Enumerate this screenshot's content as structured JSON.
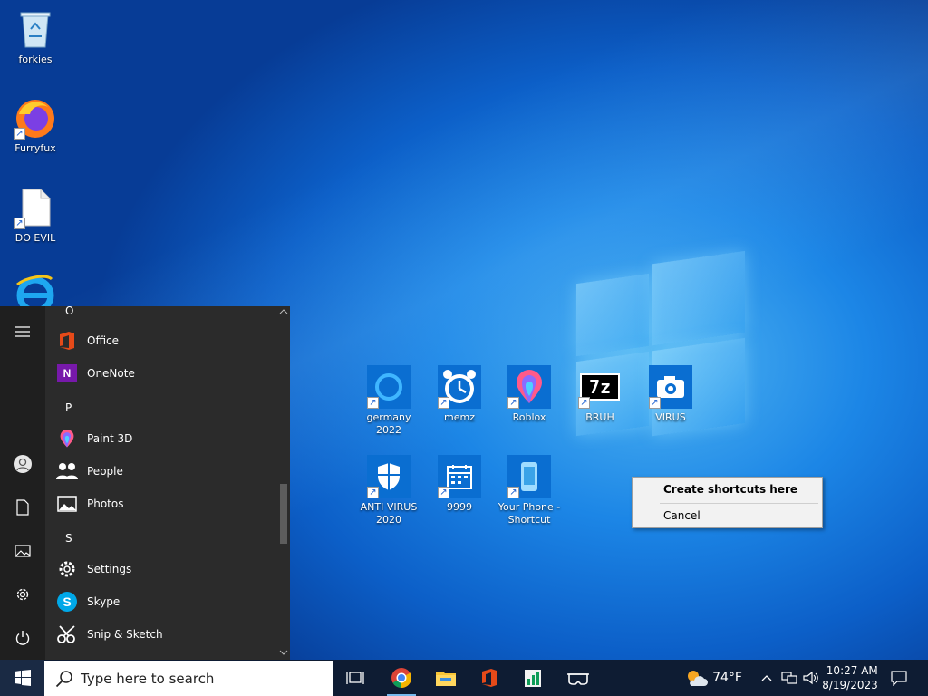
{
  "desktop": {
    "icons": [
      {
        "label": "forkies",
        "icon": "recycle-bin-icon"
      },
      {
        "label": "Furryfux",
        "icon": "firefox-icon"
      },
      {
        "label": "DO EVIL",
        "icon": "blank-file-icon"
      },
      {
        "label": "germany 2022",
        "icon": "cortana-icon"
      },
      {
        "label": "memz",
        "icon": "alarm-clock-icon"
      },
      {
        "label": "Roblox",
        "icon": "paint-3d-icon"
      },
      {
        "label": "BRUH",
        "icon": "7zip-icon"
      },
      {
        "label": "VIRUS",
        "icon": "camera-icon"
      },
      {
        "label": "ANTI VIRUS 2020",
        "icon": "shield-icon"
      },
      {
        "label": "9999",
        "icon": "calendar-icon"
      },
      {
        "label": "Your Phone - Shortcut",
        "icon": "phone-icon"
      }
    ]
  },
  "context_menu": {
    "items": [
      "Create shortcuts here",
      "Cancel"
    ]
  },
  "start_menu": {
    "headers": [
      "O",
      "P",
      "S"
    ],
    "apps": [
      "Office",
      "OneNote",
      "Paint 3D",
      "People",
      "Photos",
      "Settings",
      "Skype",
      "Snip & Sketch"
    ]
  },
  "taskbar": {
    "search_placeholder": "Type here to search",
    "weather": "74°F",
    "time": "10:27 AM",
    "date": "8/19/2023"
  },
  "colors": {
    "accent": "#0078d7",
    "taskbar": "#0e1c33",
    "start_menu": "#2b2b2b"
  }
}
